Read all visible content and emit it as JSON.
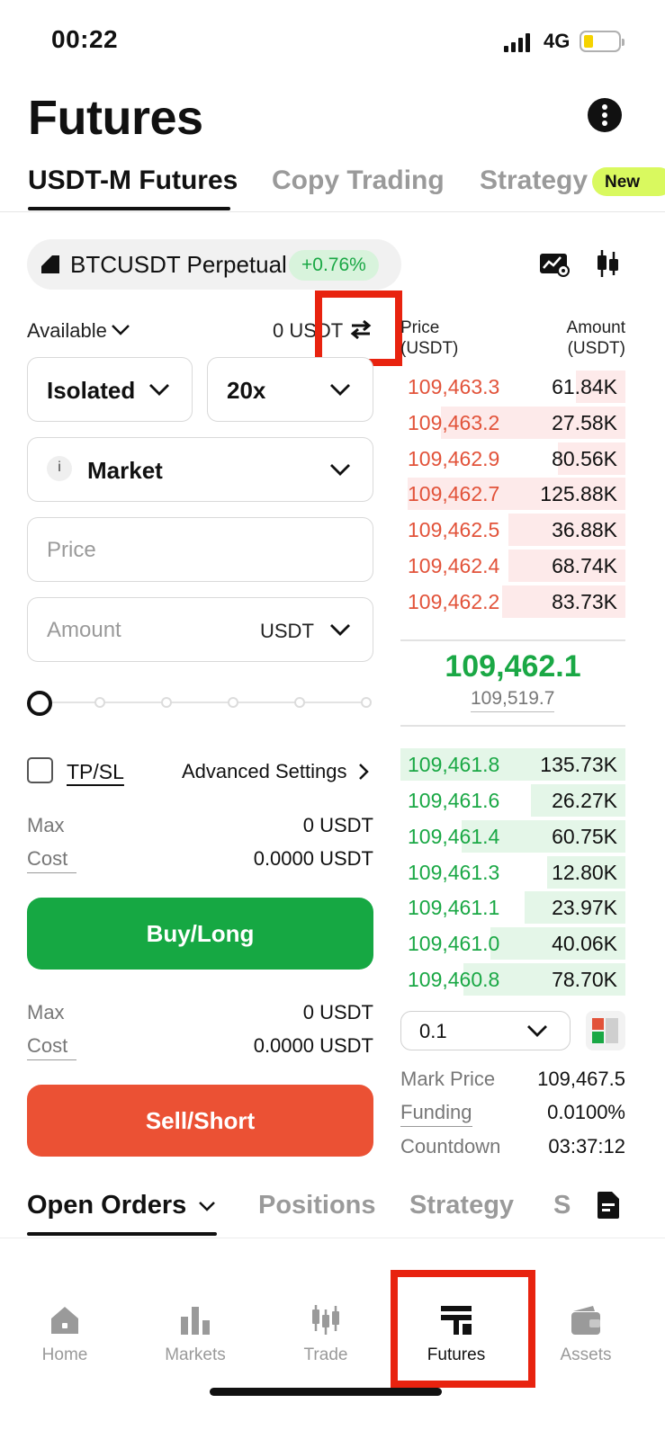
{
  "status_bar": {
    "time": "00:22",
    "network": "4G"
  },
  "header": {
    "title": "Futures"
  },
  "tabs": [
    {
      "label": "USDT-M Futures"
    },
    {
      "label": "Copy Trading"
    },
    {
      "label": "Strategy"
    }
  ],
  "new_badge": "New",
  "symbol": {
    "name": "BTCUSDT Perpetual",
    "change": "+0.76%"
  },
  "available": {
    "label": "Available",
    "value": "0 USDT"
  },
  "margin_mode": "Isolated",
  "leverage": "20x",
  "order_type": "Market",
  "price_field": {
    "placeholder": "Price"
  },
  "amount_field": {
    "placeholder": "Amount",
    "unit": "USDT"
  },
  "slider": {
    "value_percent": 0
  },
  "tpsl": {
    "label": "TP/SL",
    "checked": false
  },
  "advanced_settings": "Advanced Settings",
  "buy_info": {
    "max_label": "Max",
    "max_value": "0 USDT",
    "cost_label": "Cost",
    "cost_value": "0.0000 USDT"
  },
  "buy_button": "Buy/Long",
  "sell_info": {
    "max_label": "Max",
    "max_value": "0 USDT",
    "cost_label": "Cost",
    "cost_value": "0.0000 USDT"
  },
  "sell_button": "Sell/Short",
  "orderbook": {
    "price_header": [
      "Price",
      "(USDT)"
    ],
    "amount_header": [
      "Amount",
      "(USDT)"
    ],
    "asks": [
      {
        "price": "109,463.3",
        "amount": "61.84K",
        "depth": 0.22
      },
      {
        "price": "109,463.2",
        "amount": "27.58K",
        "depth": 0.82
      },
      {
        "price": "109,462.9",
        "amount": "80.56K",
        "depth": 0.3
      },
      {
        "price": "109,462.7",
        "amount": "125.88K",
        "depth": 0.97
      },
      {
        "price": "109,462.5",
        "amount": "36.88K",
        "depth": 0.52
      },
      {
        "price": "109,462.4",
        "amount": "68.74K",
        "depth": 0.52
      },
      {
        "price": "109,462.2",
        "amount": "83.73K",
        "depth": 0.55
      }
    ],
    "last_price": "109,462.1",
    "mark_price_small": "109,519.7",
    "bids": [
      {
        "price": "109,461.8",
        "amount": "135.73K",
        "depth": 1.0
      },
      {
        "price": "109,461.6",
        "amount": "26.27K",
        "depth": 0.42
      },
      {
        "price": "109,461.4",
        "amount": "60.75K",
        "depth": 0.73
      },
      {
        "price": "109,461.3",
        "amount": "12.80K",
        "depth": 0.35
      },
      {
        "price": "109,461.1",
        "amount": "23.97K",
        "depth": 0.45
      },
      {
        "price": "109,461.0",
        "amount": "40.06K",
        "depth": 0.6
      },
      {
        "price": "109,460.8",
        "amount": "78.70K",
        "depth": 0.72
      }
    ],
    "depth_step": "0.1"
  },
  "market_info": {
    "mark_price_label": "Mark Price",
    "mark_price_value": "109,467.5",
    "funding_label": "Funding",
    "funding_value": "0.0100%",
    "countdown_label": "Countdown",
    "countdown_value": "03:37:12"
  },
  "bottom_tabs": [
    {
      "label": "Open Orders"
    },
    {
      "label": "Positions"
    },
    {
      "label": "Strategy"
    },
    {
      "label": "S"
    }
  ],
  "nav": [
    {
      "label": "Home",
      "icon": "home-icon"
    },
    {
      "label": "Markets",
      "icon": "bar-chart-icon"
    },
    {
      "label": "Trade",
      "icon": "candlestick-icon"
    },
    {
      "label": "Futures",
      "icon": "futures-icon"
    },
    {
      "label": "Assets",
      "icon": "wallet-icon"
    }
  ],
  "colors": {
    "buy": "#16a843",
    "sell": "#eb5134",
    "ask_text": "#e2533a",
    "bid_text": "#1aa845",
    "badge": "#d9f95f",
    "highlight": "#e8230f"
  }
}
